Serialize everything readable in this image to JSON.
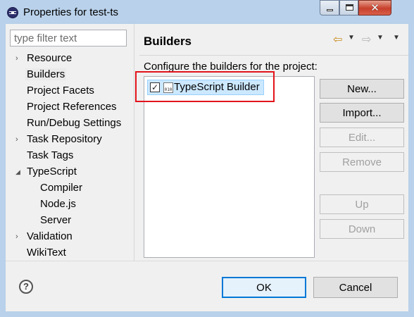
{
  "window": {
    "title": "Properties for test-ts",
    "minimize_icon": "minimize-icon",
    "maximize_icon": "maximize-icon",
    "close_icon": "close-icon"
  },
  "sidebar": {
    "filter_placeholder": "type filter text",
    "items": [
      {
        "label": "Resource",
        "expandable": "collapsed"
      },
      {
        "label": "Builders",
        "selected": true
      },
      {
        "label": "Project Facets"
      },
      {
        "label": "Project References"
      },
      {
        "label": "Run/Debug Settings"
      },
      {
        "label": "Task Repository",
        "expandable": "collapsed"
      },
      {
        "label": "Task Tags"
      },
      {
        "label": "TypeScript",
        "expandable": "expanded"
      },
      {
        "label": "Compiler",
        "level": 2
      },
      {
        "label": "Node.js",
        "level": 2
      },
      {
        "label": "Server",
        "level": 2
      },
      {
        "label": "Validation",
        "expandable": "collapsed"
      },
      {
        "label": "WikiText"
      }
    ]
  },
  "main": {
    "title": "Builders",
    "description": "Configure the builders for the project:",
    "builders": [
      {
        "name": "TypeScript Builder",
        "checked": true,
        "icon_text": "010"
      }
    ],
    "buttons": {
      "new": "New...",
      "import": "Import...",
      "edit": "Edit...",
      "remove": "Remove",
      "up": "Up",
      "down": "Down"
    }
  },
  "footer": {
    "help_symbol": "?",
    "ok": "OK",
    "cancel": "Cancel"
  },
  "colors": {
    "highlight_border": "#e2141c",
    "selection": "#cce8ff",
    "default_button_border": "#0078d7"
  }
}
